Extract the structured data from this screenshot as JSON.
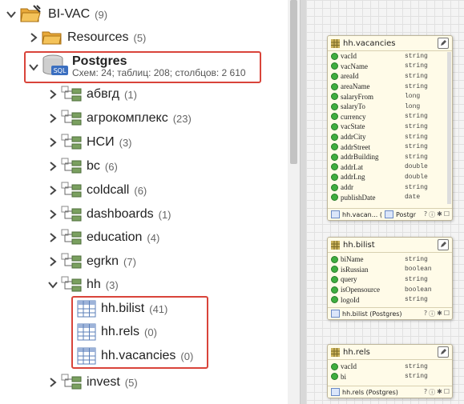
{
  "tree": {
    "root": {
      "label": "BI-VAC",
      "count": "(9)"
    },
    "resources": {
      "label": "Resources",
      "count": "(5)"
    },
    "postgres": {
      "label": "Postgres",
      "stats": "Схем: 24; таблиц: 208; столбцов: 2 610"
    },
    "schemas": [
      {
        "label": "абвгд",
        "count": "(1)"
      },
      {
        "label": "агрокомплекс",
        "count": "(23)"
      },
      {
        "label": "НСИ",
        "count": "(3)"
      },
      {
        "label": "bc",
        "count": "(6)"
      },
      {
        "label": "coldcall",
        "count": "(6)"
      },
      {
        "label": "dashboards",
        "count": "(1)"
      },
      {
        "label": "education",
        "count": "(4)"
      },
      {
        "label": "egrkn",
        "count": "(7)"
      },
      {
        "label": "hh",
        "count": "(3)"
      }
    ],
    "hh_tables": [
      {
        "label": "hh.bilist",
        "count": "(41)"
      },
      {
        "label": "hh.rels",
        "count": "(0)"
      },
      {
        "label": "hh.vacancies",
        "count": "(0)"
      }
    ],
    "invest": {
      "label": "invest",
      "count": "(5)"
    }
  },
  "cards": {
    "vacancies": {
      "title": "hh.vacancies",
      "fields": [
        {
          "name": "vacId",
          "type": "string"
        },
        {
          "name": "vacName",
          "type": "string"
        },
        {
          "name": "areaId",
          "type": "string"
        },
        {
          "name": "areaName",
          "type": "string"
        },
        {
          "name": "salaryFrom",
          "type": "long"
        },
        {
          "name": "salaryTo",
          "type": "long"
        },
        {
          "name": "currency",
          "type": "string"
        },
        {
          "name": "vacState",
          "type": "string"
        },
        {
          "name": "addrCity",
          "type": "string"
        },
        {
          "name": "addrStreet",
          "type": "string"
        },
        {
          "name": "addrBuilding",
          "type": "string"
        },
        {
          "name": "addrLat",
          "type": "double"
        },
        {
          "name": "addrLng",
          "type": "double"
        },
        {
          "name": "addr",
          "type": "string"
        },
        {
          "name": "publishDate",
          "type": "date"
        }
      ],
      "footer": "hh.vacan... (",
      "footer_source": "Postgr"
    },
    "bilist": {
      "title": "hh.bilist",
      "fields": [
        {
          "name": "biName",
          "type": "string"
        },
        {
          "name": "isRussian",
          "type": "boolean"
        },
        {
          "name": "query",
          "type": "string"
        },
        {
          "name": "isOpensource",
          "type": "boolean"
        },
        {
          "name": "logoId",
          "type": "string"
        }
      ],
      "footer": "hh.bilist (",
      "footer_source": "Postgres)"
    },
    "rels": {
      "title": "hh.rels",
      "fields": [
        {
          "name": "vacId",
          "type": "string"
        },
        {
          "name": "bi",
          "type": "string"
        }
      ],
      "footer": "hh.rels (",
      "footer_source": "Postgres)"
    }
  },
  "colors": {
    "highlight": "#d9443a",
    "field_dot": "#3fae3f",
    "card_bg": "#fffbe8"
  }
}
